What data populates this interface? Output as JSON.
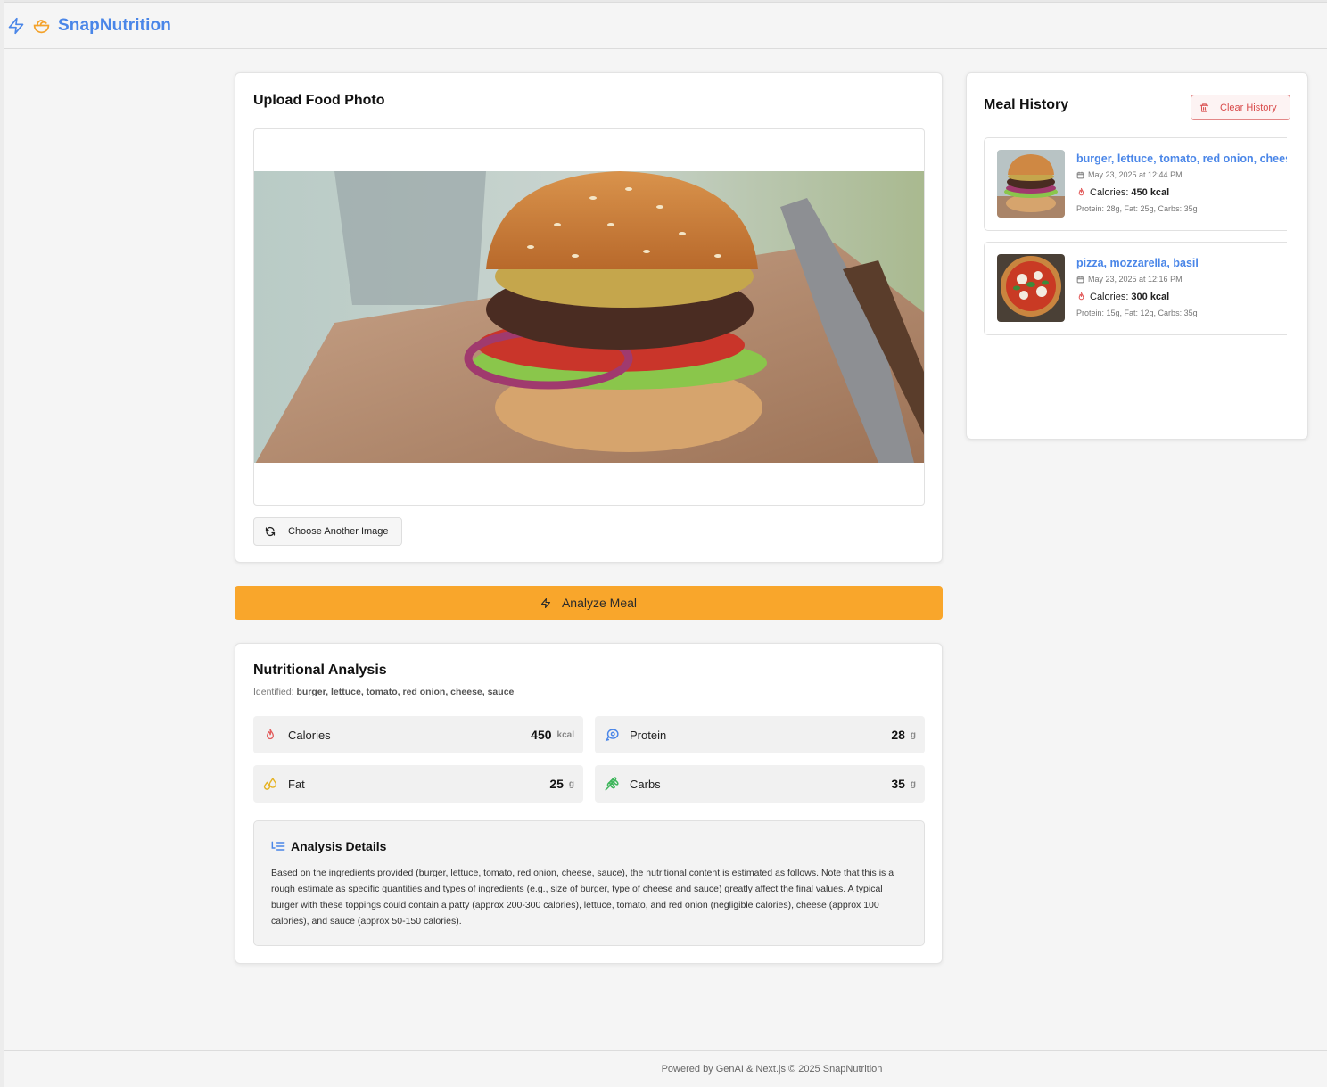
{
  "app": {
    "name": "SnapNutrition"
  },
  "upload": {
    "title": "Upload Food Photo",
    "choose_label": "Choose Another Image"
  },
  "analyze": {
    "label": "Analyze Meal"
  },
  "analysis": {
    "title": "Nutritional Analysis",
    "identified_label": "Identified:",
    "identified_items": "burger, lettuce, tomato, red onion, cheese, sauce",
    "metrics": [
      {
        "label": "Calories",
        "value": "450",
        "unit": "kcal",
        "icon": "flame-icon",
        "color": "#e25c5c"
      },
      {
        "label": "Protein",
        "value": "28",
        "unit": "g",
        "icon": "meat-icon",
        "color": "#4a86e8"
      },
      {
        "label": "Fat",
        "value": "25",
        "unit": "g",
        "icon": "droplets-icon",
        "color": "#e6b324"
      },
      {
        "label": "Carbs",
        "value": "35",
        "unit": "g",
        "icon": "wheat-icon",
        "color": "#3cb55a"
      }
    ],
    "details_title": "Analysis Details",
    "details_text": "Based on the ingredients provided (burger, lettuce, tomato, red onion, cheese, sauce), the nutritional content is estimated as follows. Note that this is a rough estimate as specific quantities and types of ingredients (e.g., size of burger, type of cheese and sauce) greatly affect the final values. A typical burger with these toppings could contain a patty (approx 200-300 calories), lettuce, tomato, and red onion (negligible calories), cheese (approx 100 calories), and sauce (approx 50-150 calories)."
  },
  "history": {
    "title": "Meal History",
    "clear_label": "Clear History",
    "items": [
      {
        "name": "burger, lettuce, tomato, red onion, cheese, sauce",
        "date": "May 23, 2025 at 12:44 PM",
        "calories_label": "Calories:",
        "calories": "450 kcal",
        "macros": "Protein: 28g, Fat: 25g, Carbs: 35g"
      },
      {
        "name": "pizza, mozzarella, basil",
        "date": "May 23, 2025 at 12:16 PM",
        "calories_label": "Calories:",
        "calories": "300 kcal",
        "macros": "Protein: 15g, Fat: 12g, Carbs: 35g"
      }
    ]
  },
  "footer": {
    "text": "Powered by GenAI & Next.js © 2025 SnapNutrition"
  },
  "colors": {
    "brand": "#4a86e8",
    "accent": "#f9a62b",
    "danger": "#d94b4b"
  }
}
